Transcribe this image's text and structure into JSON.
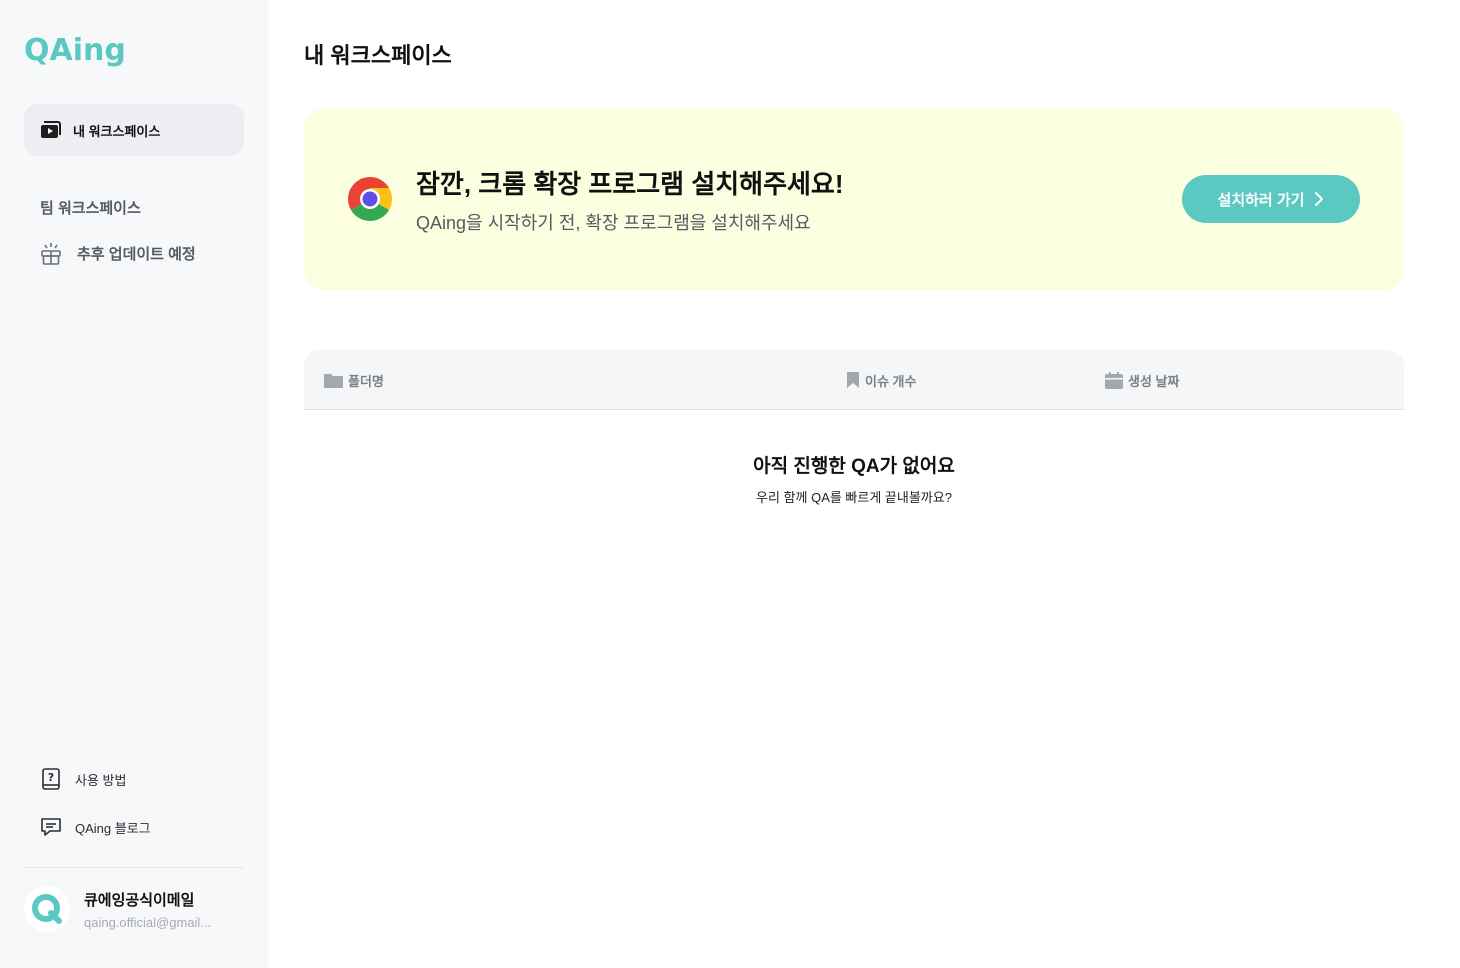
{
  "brand": {
    "logo_text": "QAing",
    "accent": "#5bc8c1"
  },
  "sidebar": {
    "my_workspace": {
      "label": "내 워크스페이스",
      "icon": "video-folder-icon"
    },
    "team_heading": "팀 워크스페이스",
    "coming_soon": {
      "label": "추후 업데이트 예정",
      "icon": "gift-icon"
    },
    "guide": {
      "label": "사용 방법",
      "icon": "help-book-icon"
    },
    "blog": {
      "label": "QAing 블로그",
      "icon": "chat-icon"
    }
  },
  "profile": {
    "name": "큐에잉공식이메일",
    "email": "qaing.official@gmail..."
  },
  "main": {
    "title": "내 워크스페이스",
    "banner": {
      "title": "잠깐, 크롬 확장 프로그램 설치해주세요!",
      "subtitle": "QAing을 시작하기 전, 확장 프로그램을 설치해주세요",
      "button_label": "설치하러 가기",
      "background": "#fbffdf"
    },
    "table": {
      "columns": [
        {
          "label": "폴더명",
          "icon": "folder-icon"
        },
        {
          "label": "이슈 개수",
          "icon": "bookmark-icon"
        },
        {
          "label": "생성 날짜",
          "icon": "calendar-icon"
        }
      ]
    },
    "empty_state": {
      "title": "아직 진행한 QA가 없어요",
      "subtitle": "우리 함께 QA를 빠르게 끝내볼까요?"
    }
  }
}
